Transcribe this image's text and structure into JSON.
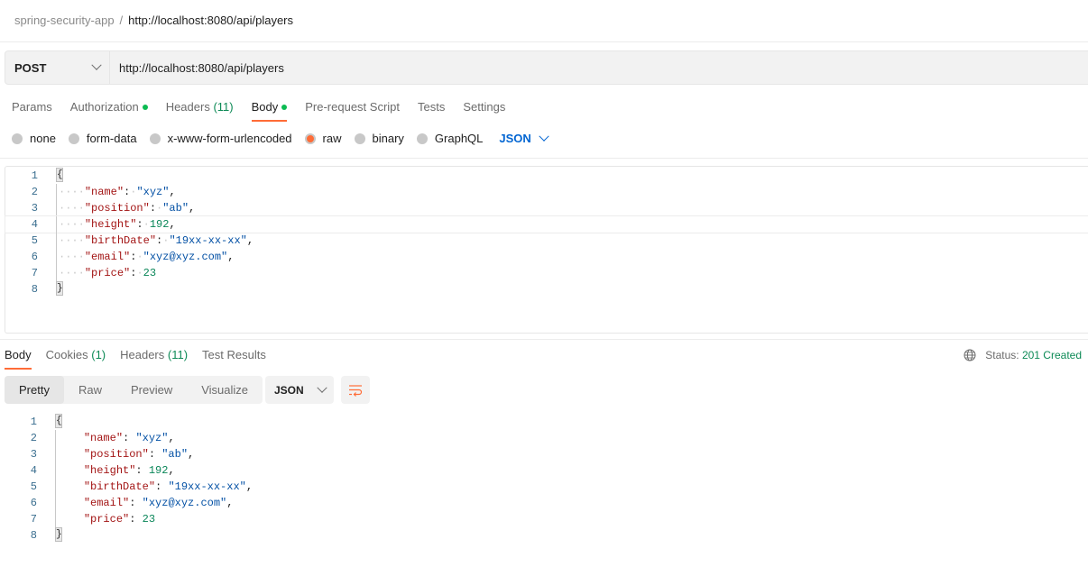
{
  "breadcrumb": {
    "collection": "spring-security-app",
    "separator": "/",
    "request": "http://localhost:8080/api/players"
  },
  "request": {
    "method": "POST",
    "url": "http://localhost:8080/api/players"
  },
  "request_tabs": [
    {
      "label": "Params"
    },
    {
      "label": "Authorization",
      "dot": true
    },
    {
      "label": "Headers",
      "count": "(11)"
    },
    {
      "label": "Body",
      "dot": true,
      "active": true
    },
    {
      "label": "Pre-request Script"
    },
    {
      "label": "Tests"
    },
    {
      "label": "Settings"
    }
  ],
  "body_types": [
    {
      "label": "none"
    },
    {
      "label": "form-data"
    },
    {
      "label": "x-www-form-urlencoded"
    },
    {
      "label": "raw",
      "checked": true
    },
    {
      "label": "binary"
    },
    {
      "label": "GraphQL"
    }
  ],
  "raw_format": "JSON",
  "request_body": {
    "line_numbers": [
      "1",
      "2",
      "3",
      "4",
      "5",
      "6",
      "7",
      "8"
    ],
    "open": "{",
    "close": "}",
    "fields": [
      {
        "key": "\"name\"",
        "value": "\"xyz\"",
        "type": "str",
        "comma": ","
      },
      {
        "key": "\"position\"",
        "value": "\"ab\"",
        "type": "str",
        "comma": ","
      },
      {
        "key": "\"height\"",
        "value": "192",
        "type": "num",
        "comma": ","
      },
      {
        "key": "\"birthDate\"",
        "value": "\"19xx-xx-xx\"",
        "type": "str",
        "comma": ","
      },
      {
        "key": "\"email\"",
        "value": "\"xyz@xyz.com\"",
        "type": "str",
        "comma": ","
      },
      {
        "key": "\"price\"",
        "value": "23",
        "type": "num",
        "comma": ""
      }
    ]
  },
  "response_tabs": [
    {
      "label": "Body",
      "active": true
    },
    {
      "label": "Cookies",
      "count": "(1)"
    },
    {
      "label": "Headers",
      "count": "(11)"
    },
    {
      "label": "Test Results"
    }
  ],
  "status": {
    "label": "Status:",
    "value": "201 Created",
    "icon": "globe-icon"
  },
  "view_modes": [
    "Pretty",
    "Raw",
    "Preview",
    "Visualize"
  ],
  "active_view_mode": "Pretty",
  "response_format": "JSON",
  "colors": {
    "accent": "#ff6c37",
    "success": "#0d8a56",
    "link": "#0265d2"
  }
}
